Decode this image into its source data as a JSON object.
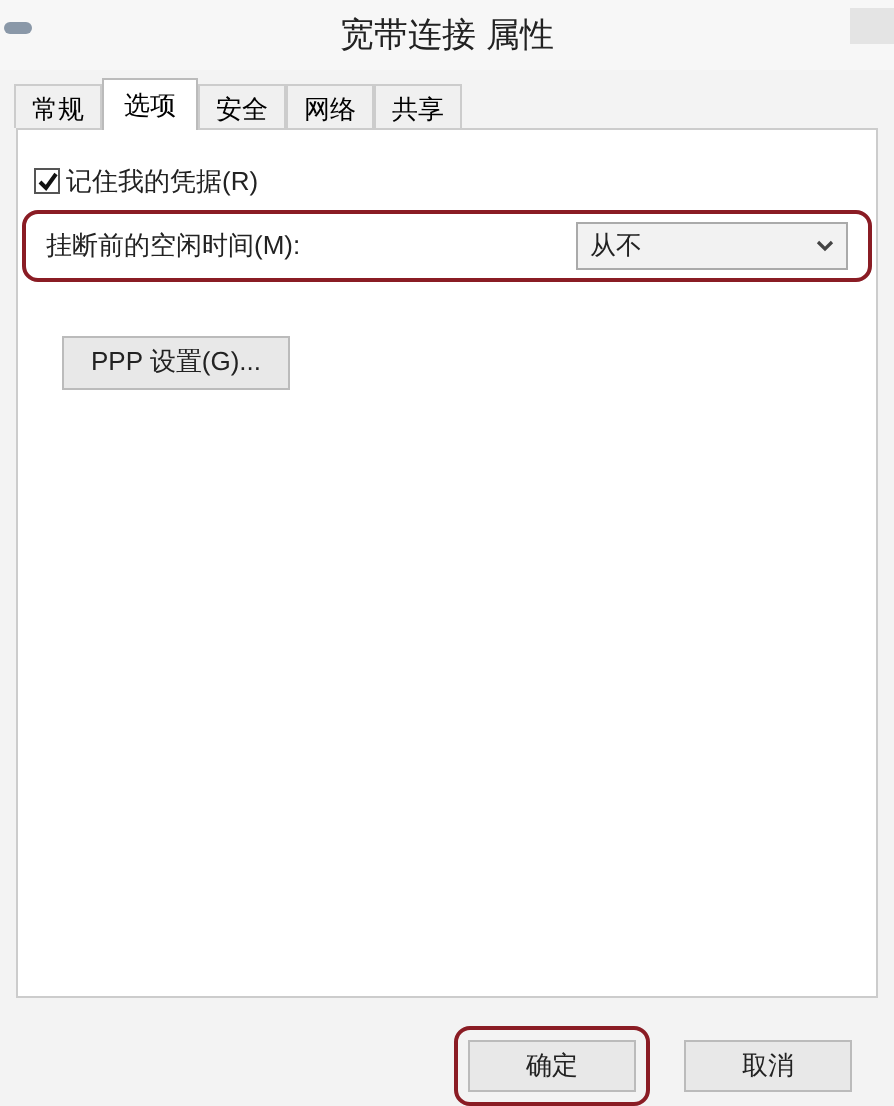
{
  "window": {
    "title": "宽带连接 属性"
  },
  "tabs": [
    {
      "label": "常规",
      "selected": false
    },
    {
      "label": "选项",
      "selected": true
    },
    {
      "label": "安全",
      "selected": false
    },
    {
      "label": "网络",
      "selected": false
    },
    {
      "label": "共享",
      "selected": false
    }
  ],
  "remember_credentials": {
    "label": "记住我的凭据(R)",
    "checked": true
  },
  "idle_time": {
    "label": "挂断前的空闲时间(M):",
    "value": "从不",
    "highlighted": true
  },
  "ppp_button": {
    "label": "PPP 设置(G)..."
  },
  "buttons": [
    {
      "label": "确定",
      "highlighted": true
    },
    {
      "label": "取消",
      "highlighted": false
    }
  ]
}
